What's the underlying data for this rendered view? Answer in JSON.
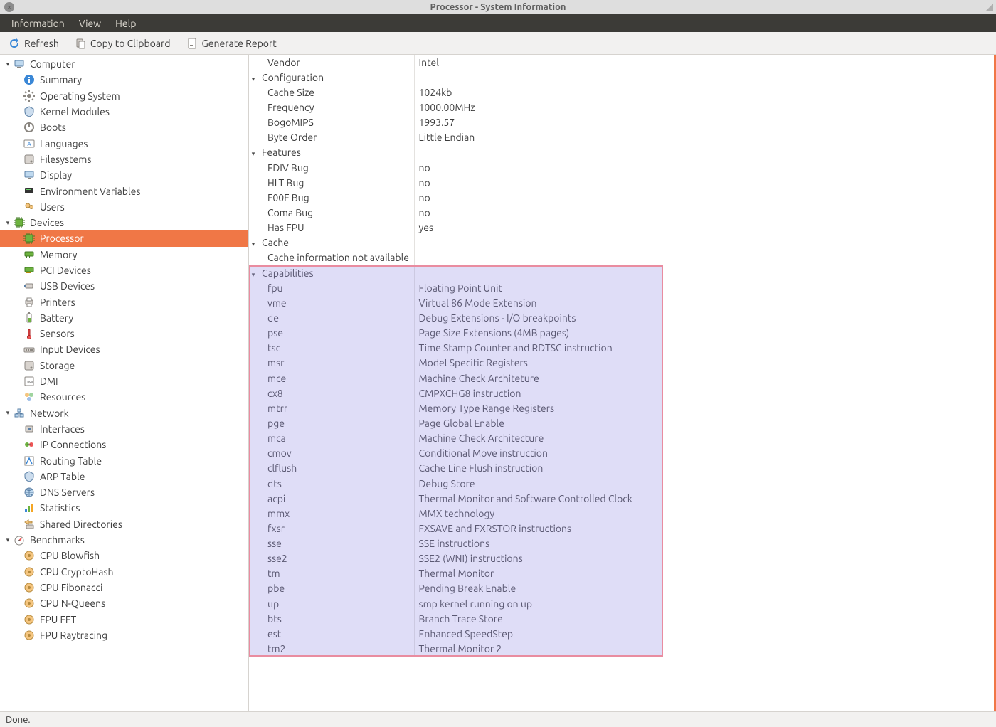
{
  "window": {
    "title": "Processor - System Information"
  },
  "menubar": {
    "items": [
      "Information",
      "View",
      "Help"
    ]
  },
  "toolbar": {
    "refresh": "Refresh",
    "copy": "Copy to Clipboard",
    "report": "Generate Report"
  },
  "statusbar": {
    "text": "Done."
  },
  "sidebar": {
    "groups": [
      {
        "label": "Computer",
        "icon": "computer-icon",
        "items": [
          {
            "label": "Summary",
            "icon": "info-icon"
          },
          {
            "label": "Operating System",
            "icon": "gear-icon"
          },
          {
            "label": "Kernel Modules",
            "icon": "module-icon"
          },
          {
            "label": "Boots",
            "icon": "power-icon"
          },
          {
            "label": "Languages",
            "icon": "language-icon"
          },
          {
            "label": "Filesystems",
            "icon": "disk-icon"
          },
          {
            "label": "Display",
            "icon": "display-icon"
          },
          {
            "label": "Environment Variables",
            "icon": "env-icon"
          },
          {
            "label": "Users",
            "icon": "users-icon"
          }
        ]
      },
      {
        "label": "Devices",
        "icon": "chip-icon",
        "items": [
          {
            "label": "Processor",
            "icon": "chip-icon",
            "selected": true
          },
          {
            "label": "Memory",
            "icon": "memory-icon"
          },
          {
            "label": "PCI Devices",
            "icon": "pci-icon"
          },
          {
            "label": "USB Devices",
            "icon": "usb-icon"
          },
          {
            "label": "Printers",
            "icon": "printer-icon"
          },
          {
            "label": "Battery",
            "icon": "battery-icon"
          },
          {
            "label": "Sensors",
            "icon": "sensor-icon"
          },
          {
            "label": "Input Devices",
            "icon": "input-icon"
          },
          {
            "label": "Storage",
            "icon": "disk-icon"
          },
          {
            "label": "DMI",
            "icon": "dmi-icon"
          },
          {
            "label": "Resources",
            "icon": "resources-icon"
          }
        ]
      },
      {
        "label": "Network",
        "icon": "network-icon",
        "items": [
          {
            "label": "Interfaces",
            "icon": "interface-icon"
          },
          {
            "label": "IP Connections",
            "icon": "ipconn-icon"
          },
          {
            "label": "Routing Table",
            "icon": "route-icon"
          },
          {
            "label": "ARP Table",
            "icon": "arp-icon"
          },
          {
            "label": "DNS Servers",
            "icon": "dns-icon"
          },
          {
            "label": "Statistics",
            "icon": "stats-icon"
          },
          {
            "label": "Shared Directories",
            "icon": "share-icon"
          }
        ]
      },
      {
        "label": "Benchmarks",
        "icon": "benchmark-icon",
        "items": [
          {
            "label": "CPU Blowfish",
            "icon": "bench-icon"
          },
          {
            "label": "CPU CryptoHash",
            "icon": "bench-icon"
          },
          {
            "label": "CPU Fibonacci",
            "icon": "bench-icon"
          },
          {
            "label": "CPU N-Queens",
            "icon": "bench-icon"
          },
          {
            "label": "FPU FFT",
            "icon": "bench-icon"
          },
          {
            "label": "FPU Raytracing",
            "icon": "bench-icon"
          }
        ]
      }
    ]
  },
  "details": {
    "top_row": {
      "key": "Vendor",
      "val": "Intel"
    },
    "sections": [
      {
        "header": "Configuration",
        "rows": [
          {
            "key": "Cache Size",
            "val": "1024kb"
          },
          {
            "key": "Frequency",
            "val": "1000.00MHz"
          },
          {
            "key": "BogoMIPS",
            "val": "1993.57"
          },
          {
            "key": "Byte Order",
            "val": "Little Endian"
          }
        ]
      },
      {
        "header": "Features",
        "rows": [
          {
            "key": "FDIV Bug",
            "val": "no"
          },
          {
            "key": "HLT Bug",
            "val": "no"
          },
          {
            "key": "F00F Bug",
            "val": "no"
          },
          {
            "key": "Coma Bug",
            "val": "no"
          },
          {
            "key": "Has FPU",
            "val": "yes"
          }
        ]
      },
      {
        "header": "Cache",
        "rows": [
          {
            "key": "Cache information not available",
            "val": ""
          }
        ]
      },
      {
        "header": "Capabilities",
        "highlight": true,
        "rows": [
          {
            "key": "fpu",
            "val": "Floating Point Unit"
          },
          {
            "key": "vme",
            "val": "Virtual 86 Mode Extension"
          },
          {
            "key": "de",
            "val": "Debug Extensions - I/O breakpoints"
          },
          {
            "key": "pse",
            "val": "Page Size Extensions (4MB pages)"
          },
          {
            "key": "tsc",
            "val": "Time Stamp Counter and RDTSC instruction"
          },
          {
            "key": "msr",
            "val": "Model Specific Registers"
          },
          {
            "key": "mce",
            "val": "Machine Check Architeture"
          },
          {
            "key": "cx8",
            "val": "CMPXCHG8 instruction"
          },
          {
            "key": "mtrr",
            "val": "Memory Type Range Registers"
          },
          {
            "key": "pge",
            "val": "Page Global Enable"
          },
          {
            "key": "mca",
            "val": "Machine Check Architecture"
          },
          {
            "key": "cmov",
            "val": "Conditional Move instruction"
          },
          {
            "key": "clflush",
            "val": "Cache Line Flush instruction"
          },
          {
            "key": "dts",
            "val": "Debug Store"
          },
          {
            "key": "acpi",
            "val": "Thermal Monitor and Software Controlled Clock"
          },
          {
            "key": "mmx",
            "val": "MMX technology"
          },
          {
            "key": "fxsr",
            "val": "FXSAVE and FXRSTOR instructions"
          },
          {
            "key": "sse",
            "val": "SSE instructions"
          },
          {
            "key": "sse2",
            "val": "SSE2 (WNI) instructions"
          },
          {
            "key": "tm",
            "val": "Thermal Monitor"
          },
          {
            "key": "pbe",
            "val": "Pending Break Enable"
          },
          {
            "key": "up",
            "val": "smp kernel running on up"
          },
          {
            "key": "bts",
            "val": "Branch Trace Store"
          },
          {
            "key": "est",
            "val": "Enhanced SpeedStep"
          },
          {
            "key": "tm2",
            "val": "Thermal Monitor 2"
          }
        ]
      }
    ]
  }
}
